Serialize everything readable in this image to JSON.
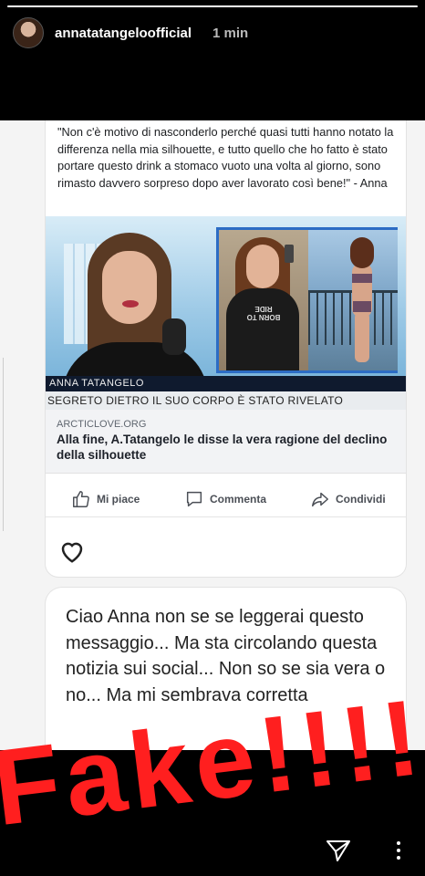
{
  "story": {
    "username": "annatatangeloofficial",
    "time": "1 min",
    "progress": 1.0
  },
  "post": {
    "quote": "\"Non c'è motivo di nasconderlo perché quasi tutti hanno notato la differenza nella mia silhouette, e tutto quello che ho fatto è stato portare questo drink a stomaco vuoto una volta al giorno, sono rimasto davvero sorpreso dopo aver lavorato così bene!\" - Anna",
    "image": {
      "caption_name": "ANNA TATANGELO",
      "caption_band": "SEGRETO DIETRO IL SUO CORPO È STATO RIVELATO",
      "shirt_text": "BORN TO RIDE"
    },
    "link": {
      "domain": "ARCTICLOVE.ORG",
      "title": "Alla fine, A.Tatangelo le disse la vera ragione del declino della silhouette"
    },
    "actions": {
      "like": "Mi piace",
      "comment": "Commenta",
      "share": "Condividi"
    }
  },
  "message": {
    "text": "Ciao Anna non se se leggerai questo messaggio... Ma sta circolando questa notizia sui social... Non so se sia vera o no... Ma mi sembrava corretta"
  },
  "overlay": {
    "sticker_text": "Fake!!!!!!",
    "color": "#ff1f1f"
  },
  "icons": {
    "send": "send-icon",
    "more": "more-vertical-icon",
    "like": "thumbs-up-icon",
    "comment": "comment-bubble-icon",
    "share": "share-arrow-icon",
    "heart": "heart-icon"
  }
}
